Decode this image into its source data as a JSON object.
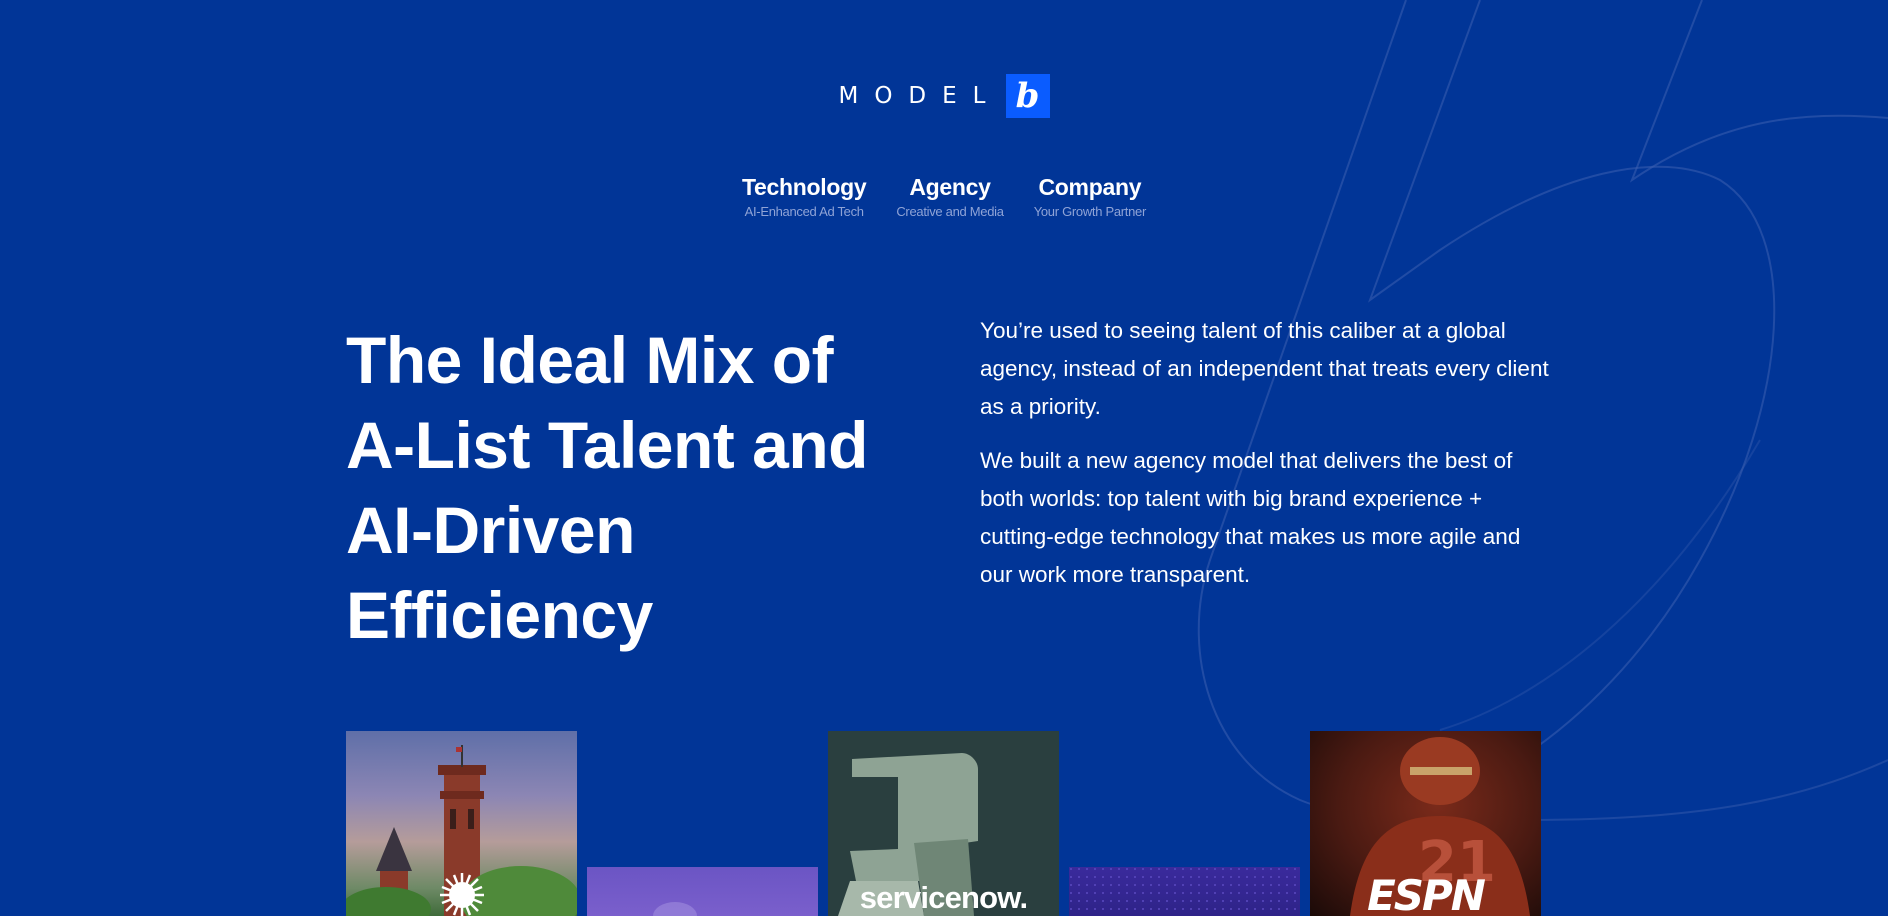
{
  "brand": {
    "logo_word": "MODEL",
    "logo_badge": "b"
  },
  "nav": {
    "items": [
      {
        "title": "Technology",
        "subtitle": "AI-Enhanced Ad Tech"
      },
      {
        "title": "Agency",
        "subtitle": "Creative and Media"
      },
      {
        "title": "Company",
        "subtitle": "Your Growth Partner"
      }
    ]
  },
  "hero": {
    "title": "The Ideal Mix of A-List Talent and AI-Driven Efficiency",
    "paragraphs": [
      "You’re used to seeing talent of this caliber at a global agency, instead of an independent that treats every client as a priority.",
      "We built a new agency model that delivers the best of both worlds: top talent with big brand experience + cutting-edge technology that makes us more agile and our work more transparent."
    ]
  },
  "tiles": {
    "servicenow_label": "servicenow.",
    "espn_label": "ESPN"
  },
  "colors": {
    "background": "#013597",
    "accent": "#0a5cff",
    "nav_subtitle": "#8fa3d6"
  }
}
